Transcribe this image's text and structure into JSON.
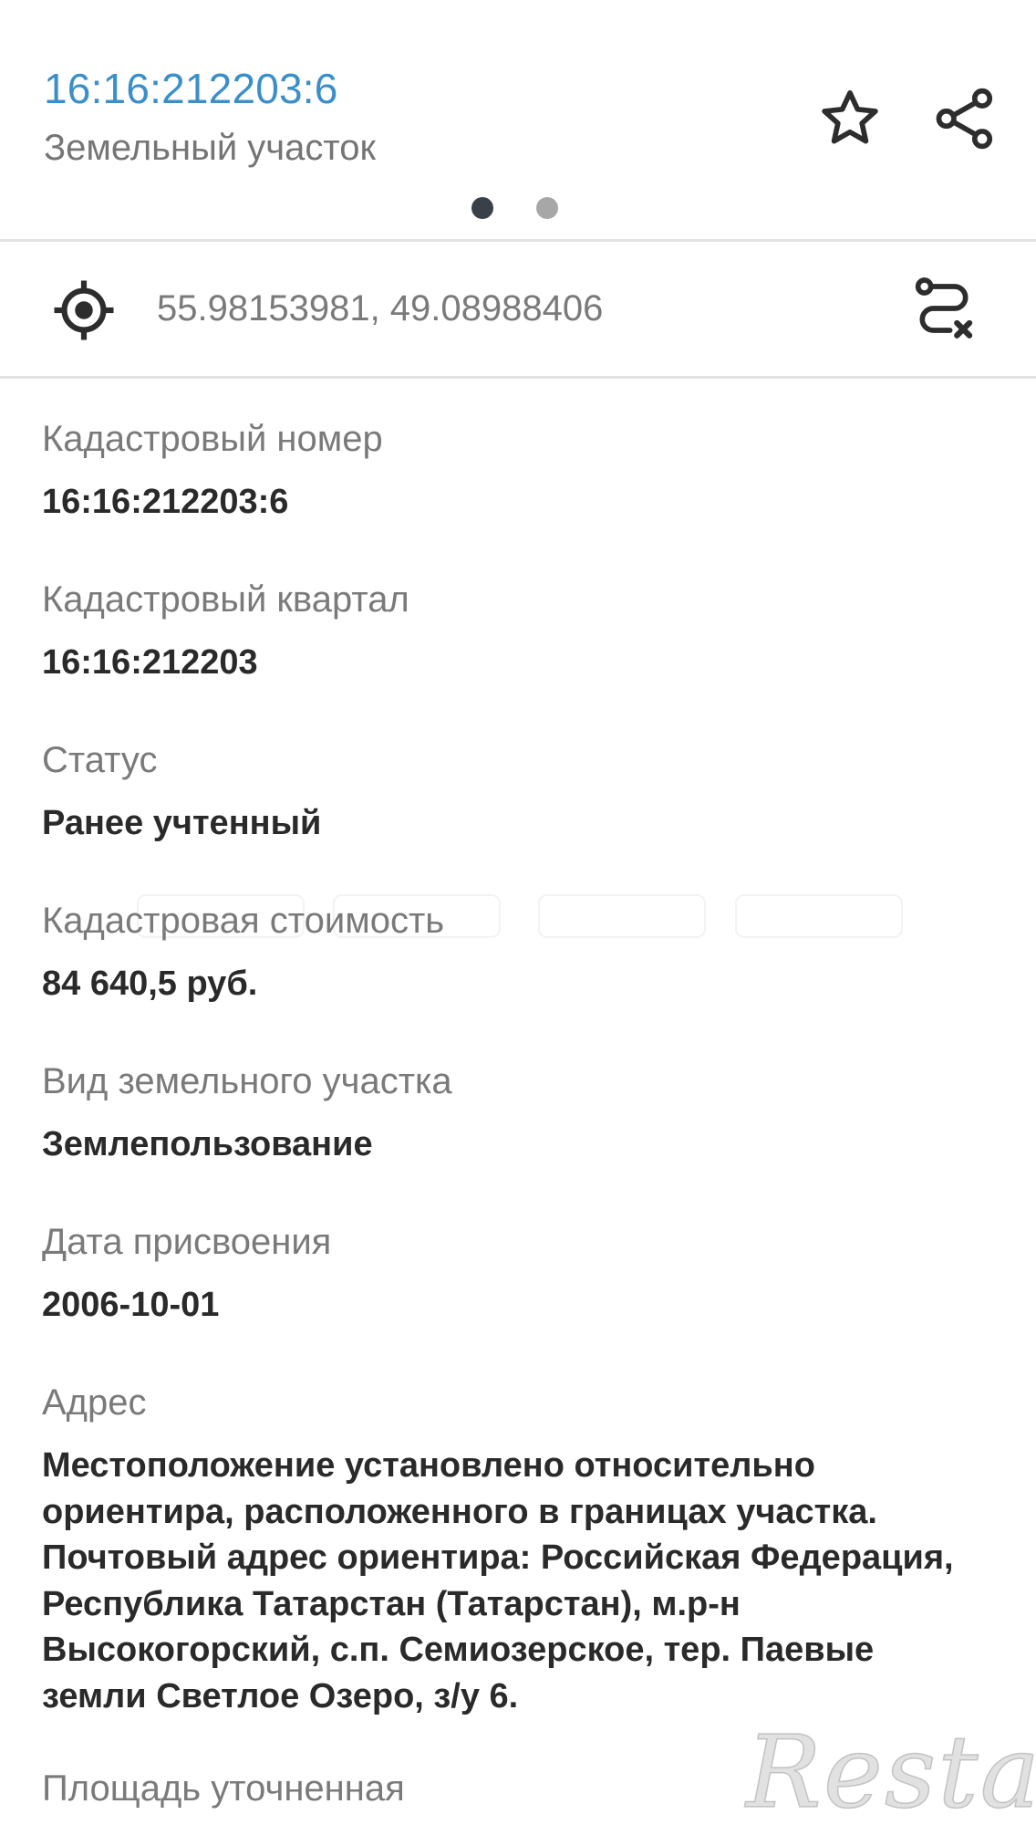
{
  "header": {
    "cadastral_number": "16:16:212203:6",
    "object_type": "Земельный участок",
    "star_icon": "star-outline-icon",
    "share_icon": "share-icon",
    "pager": {
      "count": 2,
      "active_index": 0
    }
  },
  "location": {
    "coordinates": "55.98153981, 49.08988406",
    "locate_icon": "crosshair-icon",
    "route_icon": "route-clear-icon"
  },
  "fields": [
    {
      "label": "Кадастровый номер",
      "value": "16:16:212203:6"
    },
    {
      "label": "Кадастровый квартал",
      "value": "16:16:212203"
    },
    {
      "label": "Статус",
      "value": "Ранее учтенный"
    },
    {
      "label": "Кадастровая стоимость",
      "value": "84 640,5 руб."
    },
    {
      "label": "Вид земельного участка",
      "value": "Землепользование"
    },
    {
      "label": "Дата присвоения",
      "value": "2006-10-01"
    },
    {
      "label": "Адрес",
      "value_lines": [
        "Местоположение установлено относительно",
        "ориентира, расположенного в границах участка.",
        "Почтовый адрес ориентира: Российская Федерация,",
        "Республика Татарстан (Татарстан), м.р-н",
        "Высокогорский, с.п. Семиозерское, тер. Паевые",
        "земли Светлое Озеро, з/у 6."
      ]
    },
    {
      "label": "Площадь уточненная"
    }
  ],
  "watermark": "Restate",
  "colors": {
    "accent": "#3b8fc9",
    "label": "#7a7a7a",
    "value": "#2a2a2a",
    "divider": "#e3e3e3",
    "dot_active": "#3a4048",
    "dot_inactive": "#a7a7a7"
  }
}
